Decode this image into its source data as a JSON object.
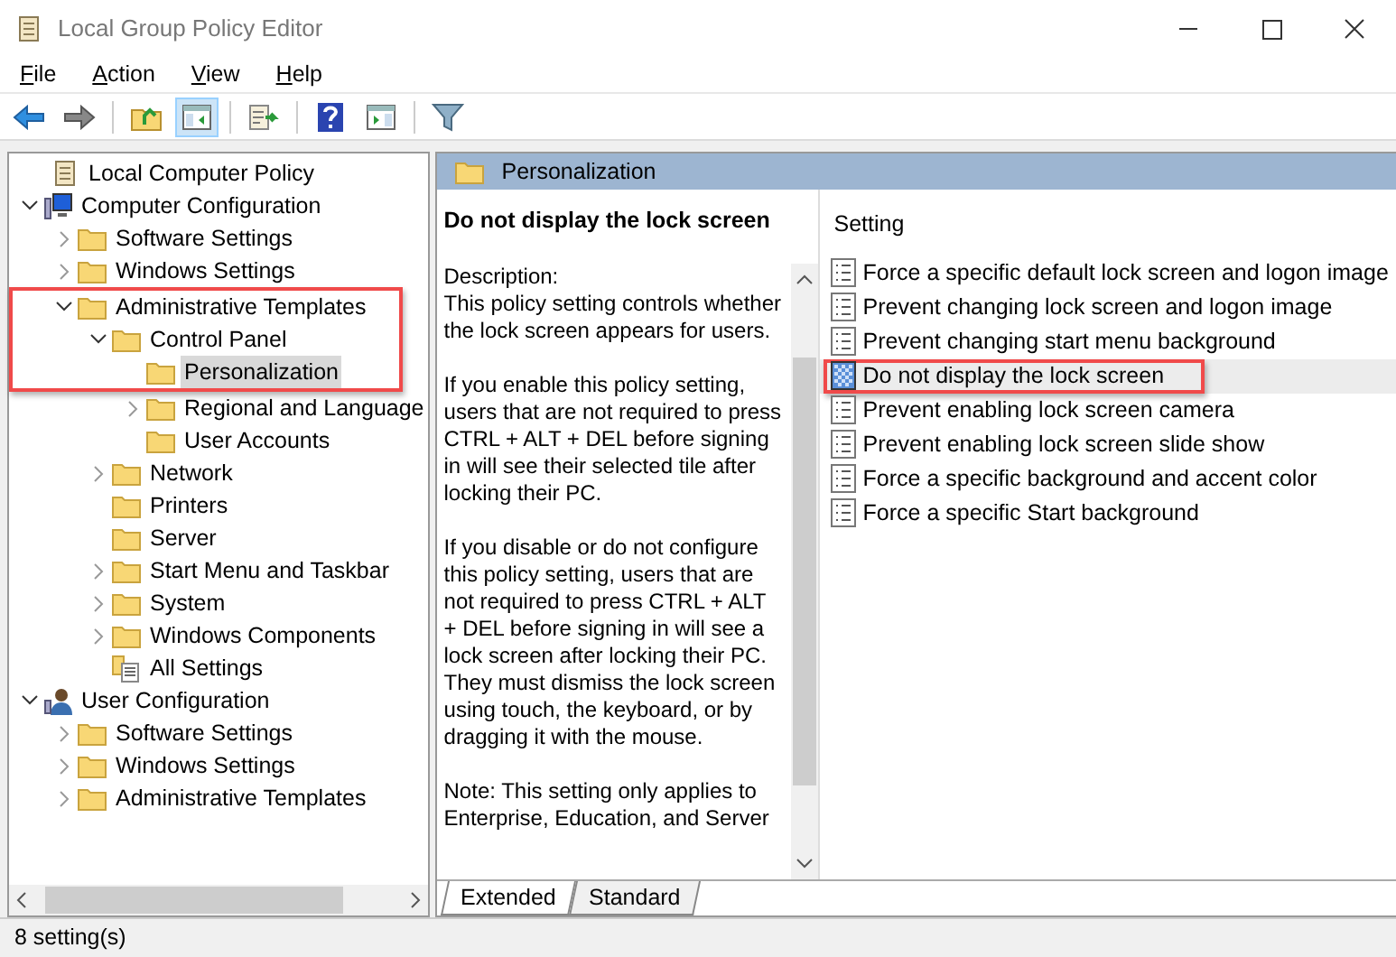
{
  "window": {
    "title": "Local Group Policy Editor"
  },
  "menu": [
    "File",
    "Action",
    "View",
    "Help"
  ],
  "toolbar": [
    {
      "pressed": false
    },
    {
      "pressed": false
    },
    {
      "pressed": false
    },
    {
      "pressed": true
    },
    {
      "pressed": false
    },
    {
      "pressed": false
    },
    {
      "pressed": false
    },
    {
      "pressed": false
    }
  ],
  "tree": [
    {
      "label": "Local Computer Policy",
      "kind": "policy",
      "selected": false,
      "highlighted": false
    },
    {
      "label": "Computer Configuration",
      "kind": "computer",
      "expanded": true,
      "selected": false,
      "highlighted": false,
      "children": [
        {
          "label": "Software Settings",
          "kind": "folder",
          "expanded": false,
          "selected": false,
          "highlighted": false
        },
        {
          "label": "Windows Settings",
          "kind": "folder",
          "expanded": false,
          "selected": false,
          "highlighted": false
        },
        {
          "label": "Administrative Templates",
          "kind": "folder",
          "expanded": true,
          "selected": false,
          "highlighted": true,
          "children": [
            {
              "label": "Control Panel",
              "kind": "folder",
              "expanded": true,
              "selected": false,
              "highlighted": true,
              "children": [
                {
                  "label": "Personalization",
                  "kind": "folder",
                  "selected": true,
                  "highlighted": true
                },
                {
                  "label": "Regional and Language",
                  "kind": "folder",
                  "expanded": false,
                  "selected": false,
                  "highlighted": false
                },
                {
                  "label": "User Accounts",
                  "kind": "folder",
                  "selected": false,
                  "highlighted": false
                }
              ]
            },
            {
              "label": "Network",
              "kind": "folder",
              "expanded": false,
              "selected": false,
              "highlighted": false
            },
            {
              "label": "Printers",
              "kind": "folder",
              "selected": false,
              "highlighted": false
            },
            {
              "label": "Server",
              "kind": "folder",
              "selected": false,
              "highlighted": false
            },
            {
              "label": "Start Menu and Taskbar",
              "kind": "folder",
              "expanded": false,
              "selected": false,
              "highlighted": false
            },
            {
              "label": "System",
              "kind": "folder",
              "expanded": false,
              "selected": false,
              "highlighted": false
            },
            {
              "label": "Windows Components",
              "kind": "folder",
              "expanded": false,
              "selected": false,
              "highlighted": false
            },
            {
              "label": "All Settings",
              "kind": "allsettings",
              "selected": false,
              "highlighted": false
            }
          ]
        }
      ]
    },
    {
      "label": "User Configuration",
      "kind": "user",
      "expanded": true,
      "selected": false,
      "highlighted": false,
      "children": [
        {
          "label": "Software Settings",
          "kind": "folder",
          "expanded": false,
          "selected": false,
          "highlighted": false
        },
        {
          "label": "Windows Settings",
          "kind": "folder",
          "expanded": false,
          "selected": false,
          "highlighted": false
        },
        {
          "label": "Administrative Templates",
          "kind": "folder",
          "expanded": false,
          "selected": false,
          "highlighted": false
        }
      ]
    }
  ],
  "details": {
    "header": "Personalization",
    "title": "Do not display the lock screen",
    "description": [
      "Description:\nThis policy setting controls whether the lock screen appears for users.",
      "If you enable this policy setting, users that are not required to press CTRL + ALT + DEL before signing in will see their selected tile after locking their PC.",
      "If you disable or do not configure this policy setting, users that are not required to press CTRL + ALT + DEL before signing in will see a lock screen after locking their PC. They must dismiss the lock screen using touch, the keyboard, or by dragging it with the mouse.",
      "Note: This setting only applies to Enterprise, Education, and Server"
    ]
  },
  "settings": {
    "column": "Setting",
    "rows": [
      {
        "name": "Force a specific default lock screen and logon image",
        "selected": false,
        "highlighted": false
      },
      {
        "name": "Prevent changing lock screen and logon image",
        "selected": false,
        "highlighted": false
      },
      {
        "name": "Prevent changing start menu background",
        "selected": false,
        "highlighted": false
      },
      {
        "name": "Do not display the lock screen",
        "selected": true,
        "highlighted": true
      },
      {
        "name": "Prevent enabling lock screen camera",
        "selected": false,
        "highlighted": false
      },
      {
        "name": "Prevent enabling lock screen slide show",
        "selected": false,
        "highlighted": false
      },
      {
        "name": "Force a specific background and accent color",
        "selected": false,
        "highlighted": false
      },
      {
        "name": "Force a specific Start background",
        "selected": false,
        "highlighted": false
      }
    ]
  },
  "tabs": [
    {
      "label": "Extended",
      "selected": true
    },
    {
      "label": "Standard",
      "selected": false
    }
  ],
  "status_bar": "8 setting(s)"
}
